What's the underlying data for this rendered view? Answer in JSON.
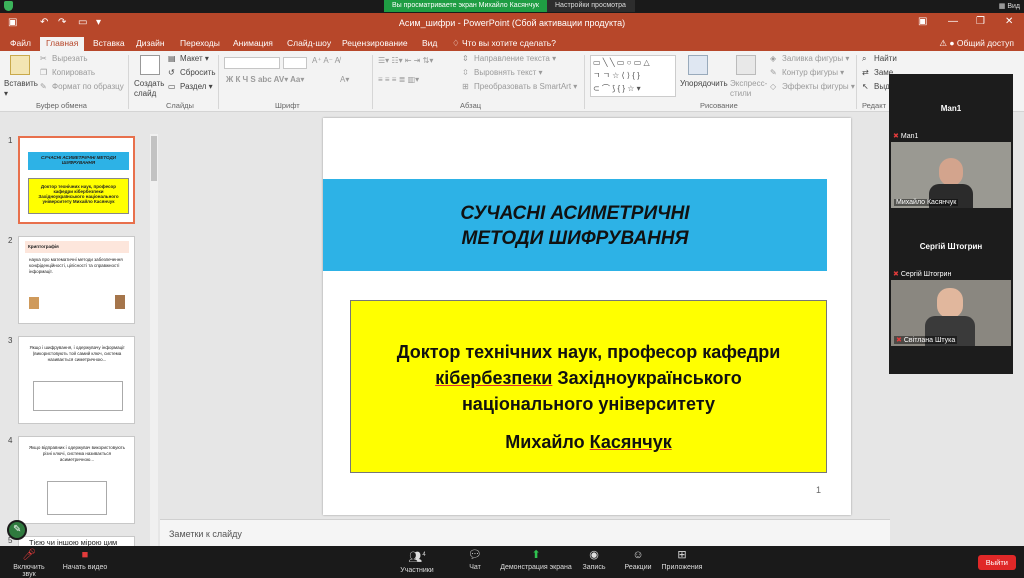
{
  "zoom": {
    "share_banner": "Вы просматриваете экран Михайло Касянчук",
    "view_options": "Настройки просмотра",
    "view_label": "Вид",
    "toolbar": {
      "mute": "Включить звук",
      "video": "Начать видео",
      "participants": "Участники",
      "participants_count": "4",
      "chat": "Чат",
      "share": "Демонстрация экрана",
      "record": "Запись",
      "reactions": "Реакции",
      "apps": "Приложения",
      "leave": "Выйти"
    },
    "panel": {
      "tile1_header": "Man1",
      "tile1_name": "Man1",
      "tile2_header": "Михайло Касянчук",
      "tile3_header": "Сергій Штогрин",
      "tile3_name": "Сергій Штогрин",
      "tile4_header": "Світлана Штука"
    }
  },
  "ppt": {
    "title": "Асим_шифри - PowerPoint (Сбой активации продукта)",
    "tabs": [
      "Файл",
      "Главная",
      "Вставка",
      "Дизайн",
      "Переходы",
      "Анимация",
      "Слайд-шоу",
      "Рецензирование",
      "Вид"
    ],
    "tell_me": "Что вы хотите сделать?",
    "share": "Общий доступ",
    "ribbon": {
      "paste": "Вставить",
      "cut": "Вырезать",
      "copy": "Копировать",
      "format_painter": "Формат по образцу",
      "clipboard_group": "Буфер обмена",
      "new_slide": "Создать слайд",
      "layout": "Макет",
      "reset": "Сбросить",
      "section": "Раздел",
      "slides_group": "Слайды",
      "font_group": "Шрифт",
      "text_direction": "Направление текста",
      "align_text": "Выровнять текст",
      "smartart": "Преобразовать в SmartArt",
      "paragraph_group": "Абзац",
      "arrange": "Упорядочить",
      "quick_styles": "Экспресс-стили",
      "shape_fill": "Заливка фигуры",
      "shape_outline": "Контур фигуры",
      "shape_effects": "Эффекты фигуры",
      "drawing_group": "Рисование",
      "find": "Найти",
      "replace": "Заме",
      "select": "Выд",
      "editing_group": "Редакт"
    },
    "thumbs": {
      "numbers": [
        "1",
        "2",
        "3",
        "4",
        "5"
      ],
      "t1_title": "СУЧАСНІ АСИМЕТРИЧНІ МЕТОДИ ШИФРУВАННЯ",
      "t1_sub": "Доктор технічних наук, професор кафедри кібербезпеки Західноукраїнського національного університету Михайло Касянчук",
      "t2_title": "Криптографія",
      "t2_body": "наука про математичні методи забезпечення конфіденційності, цілісності та справжності інформації.",
      "t3_body": "Якщо і шифрування, і одержувачу інформації (використовують той самий ключ, система називається симетричною...",
      "t4_body": "Якщо відправник і одержувач використовують різні ключі, система називається асиметричною...",
      "t5_body": "Тією чи іншою мірою цим вимогам відповідають:"
    },
    "slide": {
      "title": "СУЧАСНІ АСИМЕТРИЧНІ МЕТОДИ ШИФРУВАННЯ",
      "sub_line1": "Доктор технічних наук, професор кафедри",
      "sub_line2a": "кібербезпеки",
      "sub_line2b": "Західноукраїнського",
      "sub_line3": "національного університету",
      "author_first": "Михайло",
      "author_last": "Касянчук",
      "number": "1"
    },
    "notes_placeholder": "Заметки к слайду"
  },
  "colors": {
    "ppt_accent": "#b7472a",
    "title_box": "#2db2e6",
    "sub_box": "#ffff00",
    "zoom_green": "#1f9d43",
    "leave_red": "#e02828"
  }
}
